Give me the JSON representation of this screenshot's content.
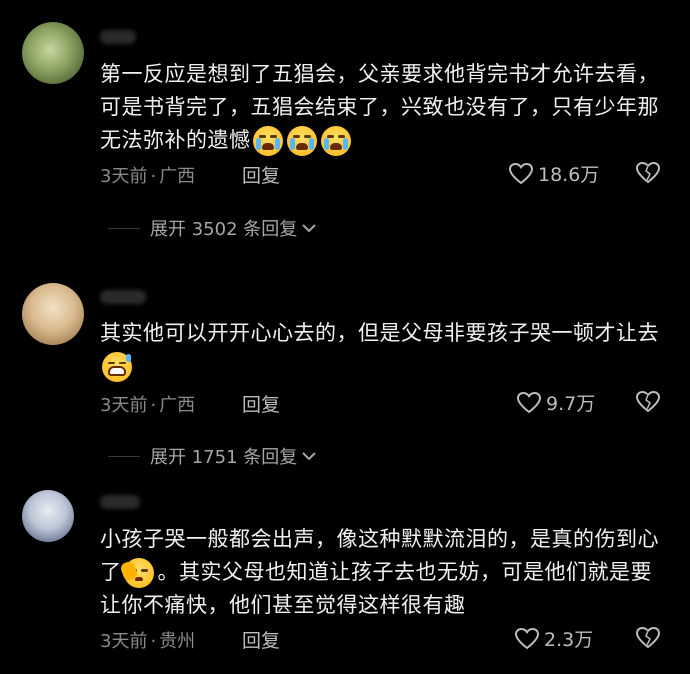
{
  "comments": [
    {
      "text": "第一反应是想到了五猖会，父亲要求他背完书才允许去看，可是书背完了，五猖会结束了，兴致也没有了，只有少年那无法弥补的遗憾",
      "time": "3天前",
      "location": "广西",
      "reply_label": "回复",
      "likes": "18.6万",
      "expand_label": "展开 3502 条回复",
      "emojis": [
        "crying-emoji",
        "crying-emoji",
        "crying-emoji"
      ]
    },
    {
      "text": "其实他可以开开心心去的，但是父母非要孩子哭一顿才让去",
      "time": "3天前",
      "location": "广西",
      "reply_label": "回复",
      "likes": "9.7万",
      "expand_label": "展开 1751 条回复",
      "emojis": [
        "sweat-grin-emoji"
      ]
    },
    {
      "text_a": "小孩子哭一般都会出声，像这种默默流泪的，是真的伤到心了",
      "text_b": "。其实父母也知道让孩子去也无妨，可是他们就是要让你不痛快，他们甚至觉得这样很有趣",
      "time": "3天前",
      "location": "贵州",
      "reply_label": "回复",
      "likes": "2.3万",
      "emojis": [
        "facepalm-emoji"
      ]
    }
  ],
  "separator": "·",
  "icons": {
    "like": "heart-icon",
    "dislike": "broken-heart-icon",
    "chevron": "chevron-down-icon"
  },
  "colors": {
    "background": "#000000",
    "text": "#f0f0f0",
    "meta": "#8a8a8a"
  }
}
